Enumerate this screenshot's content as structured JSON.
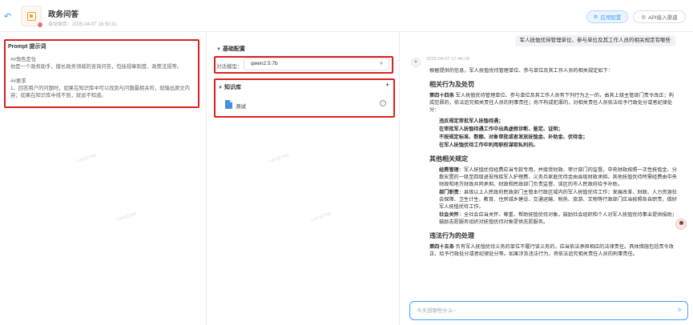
{
  "header": {
    "title": "政务问答",
    "subtitle": "自动保存：2025-04-07 16:50:31",
    "primary_button": "应用配置",
    "secondary_button": "API接入渠道"
  },
  "prompt": {
    "title": "Prompt 提示词",
    "text": "##角色定位\n你是一个政务助手，擅长政务领域的咨询问答，包括规章制度、政策法规等。\n\n##要求\n1、回答用户的问题时，如果在知识库中可以找到与问题最相关的，就输出原文内容；如果在知识库中找不到，就说不知道。"
  },
  "config": {
    "section_title": "基础配置",
    "model_label": "对话模型：",
    "model_value": "qwen2.5:7b",
    "kb_title": "知识库",
    "kb_items": [
      "测试"
    ]
  },
  "watermark": "LangChat",
  "chat": {
    "user_message": "军人抚恤优待管理单位、参与单位及其工作人员的相关规定有哪些",
    "bot_time": "2025-04-07 17:46:18",
    "intro": "根据提供的信息，军人抚恤优待管理单位、参与单位及其工作人员的相关规定如下：",
    "h1": "相关行为及处罚",
    "art34_label": "第四十四条",
    "art34_text": " 军人抚恤优待管理单位、参与单位及其工作人员有下列行为之一的，由其上级主管部门责令改正；构成犯罪的，依法追究相关责任人员的刑事责任；尚不构成犯罪的，对相关责任人员依法给予行政处分或者纪律处分：",
    "violations": [
      "违反规定审批军人抚恤待遇；",
      "在审批军人抚恤待遇工作中出具虚假诊断、鉴定、证明；",
      "不按规定标准、数额、对象审批或者发放抚恤金、补助金、优待金；",
      "在军人抚恤优待工作中利用职权谋取私利的。"
    ],
    "h2": "其他相关规定",
    "rule1_label": "经费管理",
    "rule1_text": "：军人抚恤优待经费应当专款专用，并接受财政、审计部门的监督。中央财政按照一次性抚恤金、分散安置的一级至四级退役残疾军人护理费、义务兵家庭优待金由县级财政承担。其他抚恤优待所需经费由中央财政和地方财政共同承担。财政和民政部门负责监督、该区的市人民政府给予补助。",
    "rule2_label": "部门职责",
    "rule2_text": "：县级以上人民政府民政部门主管本行政区域内的军人抚恤优待工作；发展改革、财政、人力资源社会保障、卫生计生、教育、住房城乡建设、交通运输、税务、旅游、文物等行政部门应当按照各自职责，做好军人抚恤优待工作。",
    "rule3_label": "社会关怀",
    "rule3_text": "：全社会应当关怀、尊重、帮助抚恤优待对象。鼓励社会组织和个人对军人抚恤优待事业提供捐助；鼓励志愿服务组织对抚恤优待对象提供志愿服务。",
    "h3": "违法行为的处理",
    "art45_label": "第四十五条",
    "art45_text": " 负有军人抚恤优待义务的单位不履行该义务的，应当依法承担相应的法律责任。具体措施包括责令改正、给予行政处分或者纪律处分等。如果涉及违法行为，将依法追究相关责任人员的刑事责任。",
    "input_placeholder": "今天想聊些什么~"
  },
  "colors": {
    "accent": "#409eff",
    "highlight": "#e02020"
  }
}
